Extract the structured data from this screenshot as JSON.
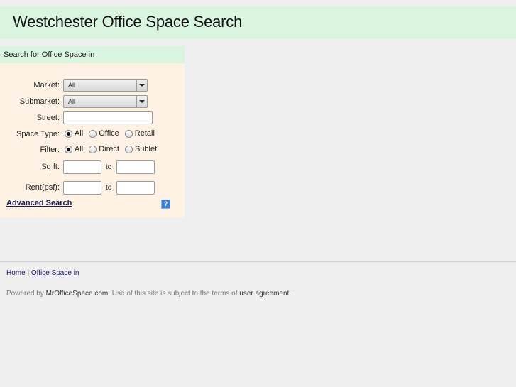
{
  "header": {
    "title": "Westchester Office Space Search"
  },
  "search": {
    "title": "Search for Office Space in",
    "market": {
      "label": "Market:",
      "value": "All"
    },
    "submarket": {
      "label": "Submarket:",
      "value": "All"
    },
    "street": {
      "label": "Street:",
      "value": ""
    },
    "space_type": {
      "label": "Space Type:",
      "options": [
        "All",
        "Office",
        "Retail"
      ],
      "selected": "All"
    },
    "filter": {
      "label": "Filter:",
      "options": [
        "All",
        "Direct",
        "Sublet"
      ],
      "selected": "All"
    },
    "sqft": {
      "label": "Sq ft:",
      "to_label": "to",
      "from_value": "",
      "to_value": ""
    },
    "rent": {
      "label": "Rent(psf):",
      "to_label": "to",
      "from_value": "",
      "to_value": ""
    },
    "advanced_link": "Advanced Search",
    "help_icon": "?"
  },
  "footer": {
    "breadcrumb": {
      "home": "Home",
      "separator": "|",
      "current": "Office Space in "
    },
    "powered_prefix": "Powered by ",
    "brand": "MrOfficeSpace.com",
    "powered_middle": ". Use of this site is subject to the terms of ",
    "agreement": "user agreement",
    "powered_suffix": "."
  },
  "colors": {
    "header_bg": "#d9f5df",
    "panel_bg": "#fdf2e4",
    "page_bg": "#efefef",
    "link": "#1a1a4e",
    "help_icon": "#3a7fd0"
  }
}
